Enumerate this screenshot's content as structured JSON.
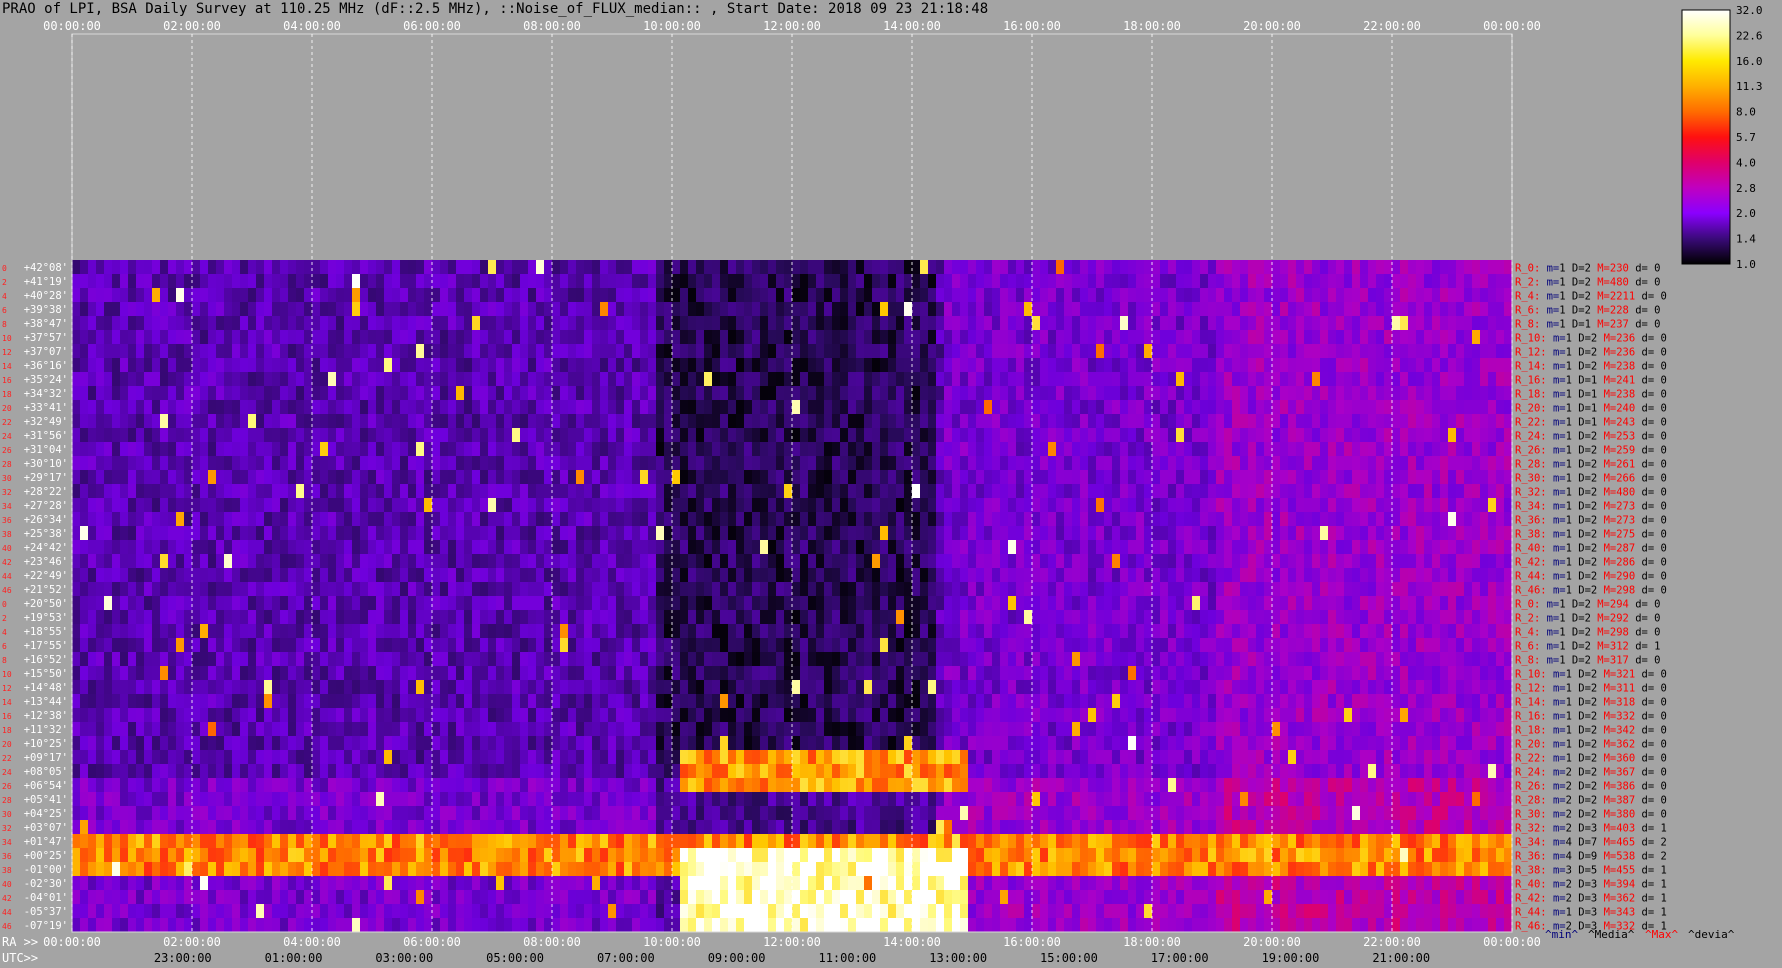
{
  "chart_data": {
    "type": "heatmap",
    "title": "PRAO of LPI, BSA Daily Survey at 110.25 MHz (dF::2.5 MHz), ::Noise_of_FLUX_median:: , Start Date: 2018 09 23 21:18:48",
    "top_time_ticks": [
      "00:00:00",
      "02:00:00",
      "04:00:00",
      "06:00:00",
      "08:00:00",
      "10:00:00",
      "12:00:00",
      "14:00:00",
      "16:00:00",
      "18:00:00",
      "20:00:00",
      "22:00:00",
      "00:00:00"
    ],
    "ra_label": "RA >>",
    "ra_ticks": [
      "00:00:00",
      "02:00:00",
      "04:00:00",
      "06:00:00",
      "08:00:00",
      "10:00:00",
      "12:00:00",
      "14:00:00",
      "16:00:00",
      "18:00:00",
      "20:00:00",
      "22:00:00",
      "00:00:00"
    ],
    "utc_label": "UTC>>",
    "utc_ticks": [
      "23:00:00",
      "01:00:00",
      "03:00:00",
      "05:00:00",
      "07:00:00",
      "09:00:00",
      "11:00:00",
      "13:00:00",
      "15:00:00",
      "17:00:00",
      "19:00:00",
      "21:00:00"
    ],
    "declinations": [
      "+42°08'",
      "+41°19'",
      "+40°28'",
      "+39°38'",
      "+38°47'",
      "+37°57'",
      "+37°07'",
      "+36°16'",
      "+35°24'",
      "+34°32'",
      "+33°41'",
      "+32°49'",
      "+31°56'",
      "+31°04'",
      "+30°10'",
      "+29°17'",
      "+28°22'",
      "+27°28'",
      "+26°34'",
      "+25°38'",
      "+24°42'",
      "+23°46'",
      "+22°49'",
      "+21°52'",
      "+20°50'",
      "+19°53'",
      "+18°55'",
      "+17°55'",
      "+16°52'",
      "+15°50'",
      "+14°48'",
      "+13°44'",
      "+12°38'",
      "+11°32'",
      "+10°25'",
      "+09°17'",
      "+08°05'",
      "+06°54'",
      "+05°41'",
      "+04°25'",
      "+03°07'",
      "+01°47'",
      "+00°25'",
      "-01°00'",
      "-02°30'",
      "-04°01'",
      "-05°37'",
      "-07°19'"
    ],
    "colorbar": {
      "ticks": [
        "32.0",
        "22.6",
        "16.0",
        "11.3",
        "8.0",
        "5.7",
        "4.0",
        "2.8",
        "2.0",
        "1.4",
        "1.0"
      ],
      "colors": [
        "#ffffff",
        "#ffff9a",
        "#ffea00",
        "#ffb000",
        "#ff6c00",
        "#ff1010",
        "#e0006a",
        "#c000c0",
        "#8a00ff",
        "#3a0a7a",
        "#000000"
      ]
    },
    "stats_header": [
      {
        "text": "^min^",
        "color": "#00007a"
      },
      {
        "text": "^Media^",
        "color": "#000000"
      },
      {
        "text": "^Max^",
        "color": "#ff0000"
      },
      {
        "text": "^devia^",
        "color": "#000000"
      }
    ],
    "stats_rows": [
      {
        "r": "R_0:",
        "m": "1",
        "D": "2",
        "M": "230",
        "d": "0"
      },
      {
        "r": "R_2:",
        "m": "1",
        "D": "2",
        "M": "480",
        "d": "0"
      },
      {
        "r": "R_4:",
        "m": "1",
        "D": "2",
        "M": "2211",
        "d": "0"
      },
      {
        "r": "R_6:",
        "m": "1",
        "D": "2",
        "M": "228",
        "d": "0"
      },
      {
        "r": "R_8:",
        "m": "1",
        "D": "1",
        "M": "237",
        "d": "0"
      },
      {
        "r": "R_10:",
        "m": "1",
        "D": "2",
        "M": "236",
        "d": "0"
      },
      {
        "r": "R_12:",
        "m": "1",
        "D": "2",
        "M": "236",
        "d": "0"
      },
      {
        "r": "R_14:",
        "m": "1",
        "D": "2",
        "M": "238",
        "d": "0"
      },
      {
        "r": "R_16:",
        "m": "1",
        "D": "1",
        "M": "241",
        "d": "0"
      },
      {
        "r": "R_18:",
        "m": "1",
        "D": "1",
        "M": "238",
        "d": "0"
      },
      {
        "r": "R_20:",
        "m": "1",
        "D": "1",
        "M": "240",
        "d": "0"
      },
      {
        "r": "R_22:",
        "m": "1",
        "D": "1",
        "M": "243",
        "d": "0"
      },
      {
        "r": "R_24:",
        "m": "1",
        "D": "2",
        "M": "253",
        "d": "0"
      },
      {
        "r": "R_26:",
        "m": "1",
        "D": "2",
        "M": "259",
        "d": "0"
      },
      {
        "r": "R_28:",
        "m": "1",
        "D": "2",
        "M": "261",
        "d": "0"
      },
      {
        "r": "R_30:",
        "m": "1",
        "D": "2",
        "M": "266",
        "d": "0"
      },
      {
        "r": "R_32:",
        "m": "1",
        "D": "2",
        "M": "480",
        "d": "0"
      },
      {
        "r": "R_34:",
        "m": "1",
        "D": "2",
        "M": "273",
        "d": "0"
      },
      {
        "r": "R_36:",
        "m": "1",
        "D": "2",
        "M": "273",
        "d": "0"
      },
      {
        "r": "R_38:",
        "m": "1",
        "D": "2",
        "M": "275",
        "d": "0"
      },
      {
        "r": "R_40:",
        "m": "1",
        "D": "2",
        "M": "287",
        "d": "0"
      },
      {
        "r": "R_42:",
        "m": "1",
        "D": "2",
        "M": "286",
        "d": "0"
      },
      {
        "r": "R_44:",
        "m": "1",
        "D": "2",
        "M": "290",
        "d": "0"
      },
      {
        "r": "R_46:",
        "m": "1",
        "D": "2",
        "M": "298",
        "d": "0"
      },
      {
        "r": "R_0:",
        "m": "1",
        "D": "2",
        "M": "294",
        "d": "0"
      },
      {
        "r": "R_2:",
        "m": "1",
        "D": "2",
        "M": "292",
        "d": "0"
      },
      {
        "r": "R_4:",
        "m": "1",
        "D": "2",
        "M": "298",
        "d": "0"
      },
      {
        "r": "R_6:",
        "m": "1",
        "D": "2",
        "M": "312",
        "d": "1"
      },
      {
        "r": "R_8:",
        "m": "1",
        "D": "2",
        "M": "317",
        "d": "0"
      },
      {
        "r": "R_10:",
        "m": "1",
        "D": "2",
        "M": "321",
        "d": "0"
      },
      {
        "r": "R_12:",
        "m": "1",
        "D": "2",
        "M": "311",
        "d": "0"
      },
      {
        "r": "R_14:",
        "m": "1",
        "D": "2",
        "M": "318",
        "d": "0"
      },
      {
        "r": "R_16:",
        "m": "1",
        "D": "2",
        "M": "332",
        "d": "0"
      },
      {
        "r": "R_18:",
        "m": "1",
        "D": "2",
        "M": "342",
        "d": "0"
      },
      {
        "r": "R_20:",
        "m": "1",
        "D": "2",
        "M": "362",
        "d": "0"
      },
      {
        "r": "R_22:",
        "m": "1",
        "D": "2",
        "M": "360",
        "d": "0"
      },
      {
        "r": "R_24:",
        "m": "2",
        "D": "2",
        "M": "367",
        "d": "0"
      },
      {
        "r": "R_26:",
        "m": "2",
        "D": "2",
        "M": "386",
        "d": "0"
      },
      {
        "r": "R_28:",
        "m": "2",
        "D": "2",
        "M": "387",
        "d": "0"
      },
      {
        "r": "R_30:",
        "m": "2",
        "D": "2",
        "M": "380",
        "d": "0"
      },
      {
        "r": "R_32:",
        "m": "2",
        "D": "3",
        "M": "403",
        "d": "1"
      },
      {
        "r": "R_34:",
        "m": "4",
        "D": "7",
        "M": "465",
        "d": "2"
      },
      {
        "r": "R_36:",
        "m": "4",
        "D": "9",
        "M": "538",
        "d": "2"
      },
      {
        "r": "R_38:",
        "m": "3",
        "D": "5",
        "M": "455",
        "d": "1"
      },
      {
        "r": "R_40:",
        "m": "2",
        "D": "3",
        "M": "394",
        "d": "1"
      },
      {
        "r": "R_42:",
        "m": "2",
        "D": "3",
        "M": "362",
        "d": "1"
      },
      {
        "r": "R_44:",
        "m": "1",
        "D": "3",
        "M": "343",
        "d": "1"
      },
      {
        "r": "R_46:",
        "m": "2",
        "D": "3",
        "M": "332",
        "d": "1"
      }
    ]
  }
}
